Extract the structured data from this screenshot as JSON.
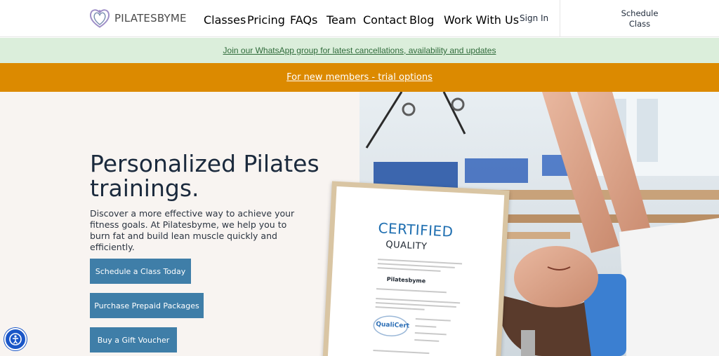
{
  "brand": {
    "name": "PILATESBYME"
  },
  "nav": {
    "items": [
      {
        "label": "Classes"
      },
      {
        "label": "Pricing"
      },
      {
        "label": "FAQs"
      },
      {
        "label": "Team"
      },
      {
        "label": "Contact"
      },
      {
        "label": "Blog"
      },
      {
        "label": "Work With Us"
      }
    ],
    "sign_in": "Sign In",
    "schedule": "Schedule Class"
  },
  "banners": {
    "whatsapp": "Join our WhatsApp group for latest cancellations, availability and updates",
    "trial": "For new members - trial options"
  },
  "hero": {
    "title": "Personalized Pilates trainings.",
    "description": "Discover a more effective way to achieve your fitness goals. At Pilatesbyme, we help you to burn fat and build lean muscle quickly and efficiently.",
    "buttons": [
      {
        "label": "Schedule a Class Today"
      },
      {
        "label": "Purchase Prepaid Packages"
      },
      {
        "label": "Buy a Gift Voucher"
      }
    ]
  },
  "certificate": {
    "title": "CERTIFIED",
    "subtitle": "QUALITY",
    "holder": "Pilatesbyme",
    "badge": "QualiCert"
  },
  "colors": {
    "accent": "#3f7ea8",
    "trial_banner": "#dc8a00",
    "whatsapp_banner": "#dbeedb",
    "hero_bg": "#f8f4f1"
  }
}
